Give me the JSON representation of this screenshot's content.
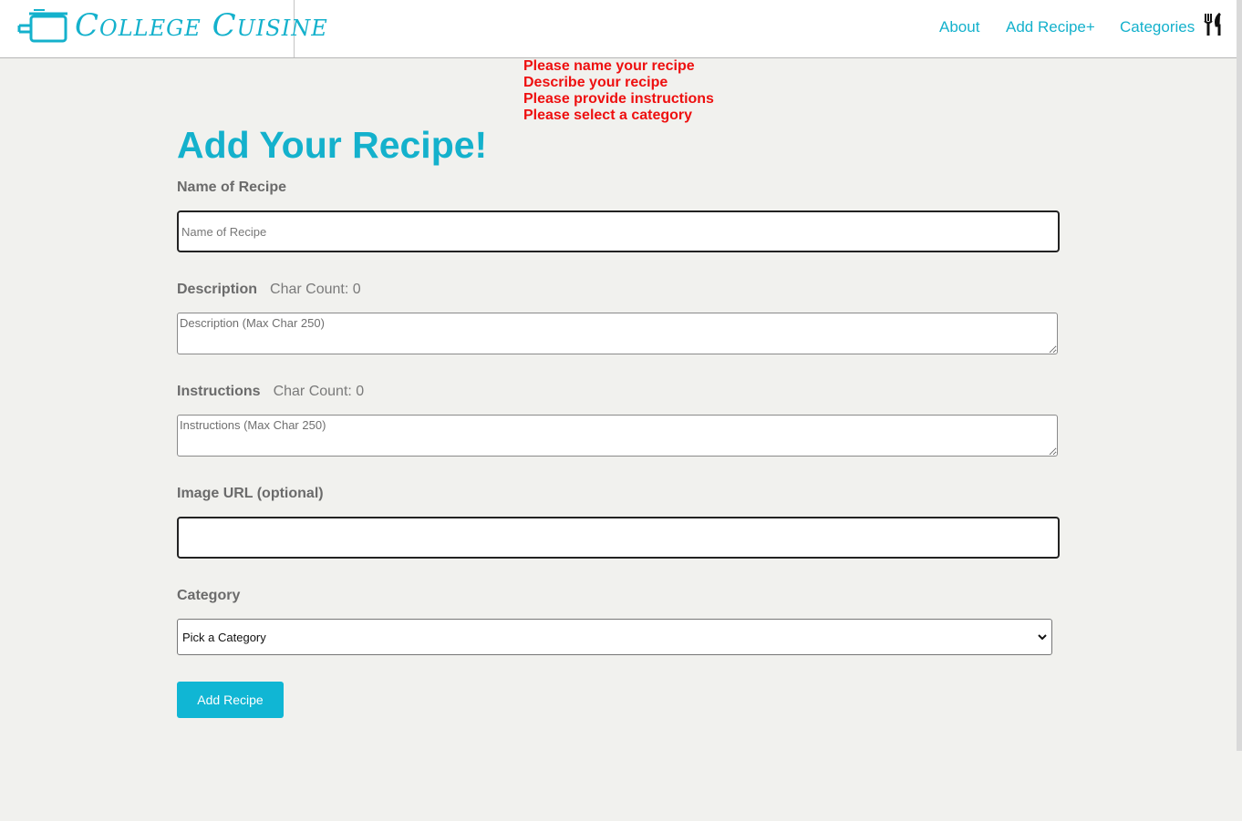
{
  "brand": {
    "name": "College Cuisine",
    "icon": "pot-icon"
  },
  "nav": {
    "about": "About",
    "add_recipe": "Add Recipe+",
    "categories": "Categories",
    "icon": "utensils-icon"
  },
  "errors": [
    "Please name your recipe",
    "Describe your recipe",
    "Please provide instructions",
    "Please select a category"
  ],
  "form": {
    "title": "Add Your Recipe!",
    "name_label": "Name of Recipe",
    "name_placeholder": "Name of Recipe",
    "description_label": "Description",
    "description_count": "Char Count: 0",
    "description_placeholder": "Description (Max Char 250)",
    "instructions_label": "Instructions",
    "instructions_count": "Char Count: 0",
    "instructions_placeholder": "Instructions (Max Char 250)",
    "image_label": "Image URL (optional)",
    "image_value": "",
    "category_label": "Category",
    "category_selected": "Pick a Category",
    "submit_label": "Add Recipe"
  },
  "colors": {
    "accent": "#14b1cc",
    "error": "#ee0f0f",
    "background": "#f1f1ee",
    "button": "#10b6d4"
  }
}
